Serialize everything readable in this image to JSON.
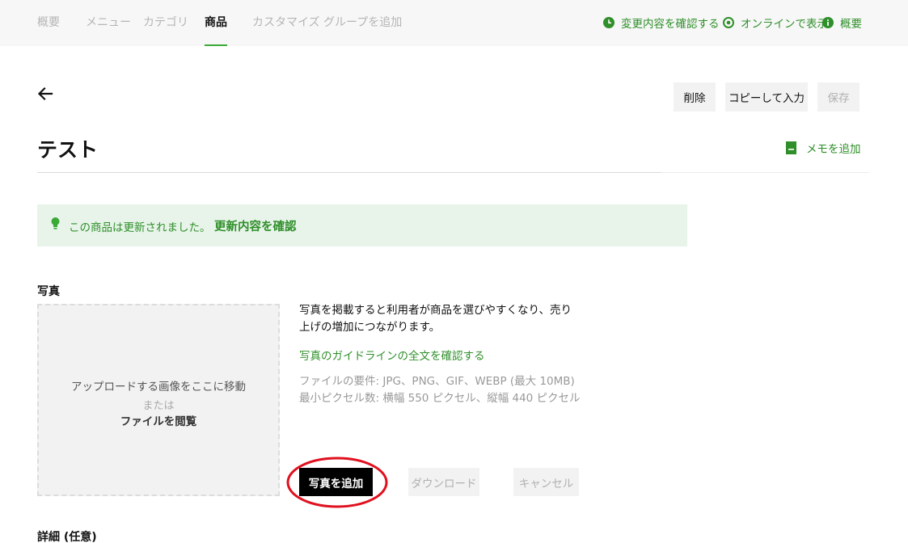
{
  "nav": {
    "tabs": [
      {
        "label": "概要"
      },
      {
        "label": "メニュー"
      },
      {
        "label": "カテゴリ"
      },
      {
        "label": "商品"
      },
      {
        "label": "カスタマイズ グループを追加"
      }
    ],
    "active_tab": "商品",
    "links": {
      "review_changes": "変更内容を確認する",
      "view_online": "オンラインで表示",
      "overview": "概要"
    }
  },
  "toolbar": {
    "delete": "削除",
    "copy_input": "コピーして入力",
    "save": "保存"
  },
  "page": {
    "title": "テスト",
    "add_memo": "メモを追加"
  },
  "notice": {
    "message": "この商品は更新されました。",
    "link": "更新内容を確認"
  },
  "photo": {
    "section_label": "写真",
    "dropzone": {
      "line1": "アップロードする画像をここに移動",
      "line2": "または",
      "line3": "ファイルを閲覧"
    },
    "description": "写真を掲載すると利用者が商品を選びやすくなり、売り上げの増加につながります。",
    "guideline_link": "写真のガイドラインの全文を確認する",
    "requirements": "ファイルの要件: JPG、PNG、GIF、WEBP (最大 10MB) 最小ピクセル数: 横幅 550 ピクセル、縦幅 440 ピクセル",
    "add_button": "写真を追加",
    "download_button": "ダウンロード",
    "cancel_button": "キャンセル"
  },
  "details": {
    "section_label": "詳細 (任意)"
  },
  "colors": {
    "accent_green": "#2f8f2a",
    "notice_bg": "#e8f4ea",
    "highlight_red": "#e0101e"
  }
}
